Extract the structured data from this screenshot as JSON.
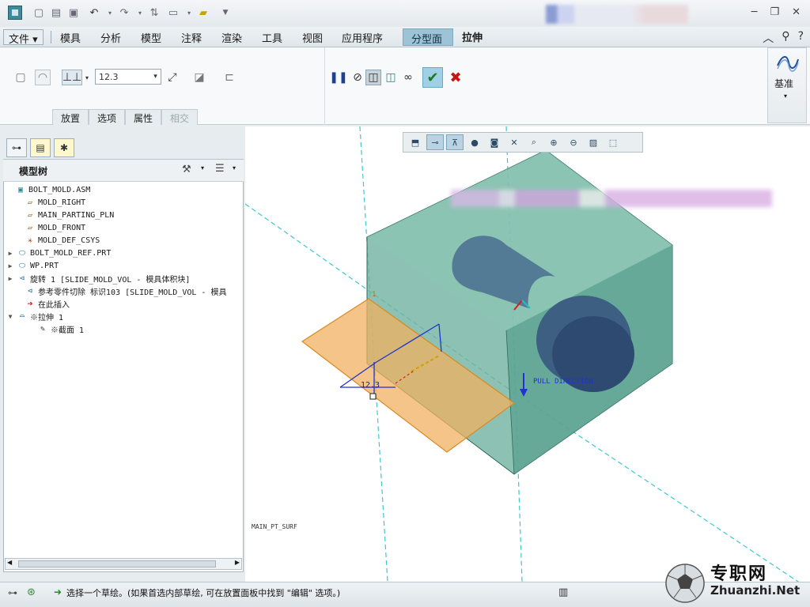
{
  "menubar": {
    "file": "文件",
    "items": [
      "模具",
      "分析",
      "模型",
      "注释",
      "渲染",
      "工具",
      "视图",
      "应用程序"
    ],
    "context_tab": "分型面",
    "active_tab": "拉伸"
  },
  "ribbon": {
    "depth_value": "12.3",
    "sub_tabs": [
      "放置",
      "选项",
      "属性",
      "相交"
    ],
    "datum_label": "基准"
  },
  "model_tree": {
    "title": "模型树",
    "items": [
      {
        "label": "BOLT_MOLD.ASM",
        "icon": "assembly-icon"
      },
      {
        "label": "MOLD_RIGHT",
        "icon": "datum-plane-icon"
      },
      {
        "label": "MAIN_PARTING_PLN",
        "icon": "datum-plane-icon"
      },
      {
        "label": "MOLD_FRONT",
        "icon": "datum-plane-icon"
      },
      {
        "label": "MOLD_DEF_CSYS",
        "icon": "csys-icon"
      },
      {
        "label": "BOLT_MOLD_REF.PRT",
        "icon": "part-icon"
      },
      {
        "label": "WP.PRT",
        "icon": "part-icon"
      },
      {
        "label": "旋转 1 [SLIDE_MOLD_VOL - 模具体积块]",
        "icon": "revolve-icon"
      },
      {
        "label": "参考零件切除 标识103 [SLIDE_MOLD_VOL - 模具",
        "icon": "cut-icon"
      },
      {
        "label": "在此插入",
        "icon": "insert-here-icon"
      },
      {
        "label": "※拉伸 1",
        "icon": "extrude-icon"
      },
      {
        "label": "※截面 1",
        "icon": "sketch-icon"
      }
    ]
  },
  "graphics": {
    "dimension_label": "12.3",
    "direction_label": "PULL DIRECTION",
    "surface_label": "MAIN_PT_SURF",
    "point_label": "1"
  },
  "status": {
    "message": "选择一个草绘。(如果首选内部草绘, 可在放置面板中找到 \"编辑\" 选项。)"
  },
  "watermark": {
    "brand": "专职网",
    "url": "Zhuanzhi.Net"
  },
  "colors": {
    "mold_block": "#6fb1a0",
    "surface": "#f0b060",
    "cylinder": "#3e5f86",
    "accent": "#2a7ab0"
  }
}
